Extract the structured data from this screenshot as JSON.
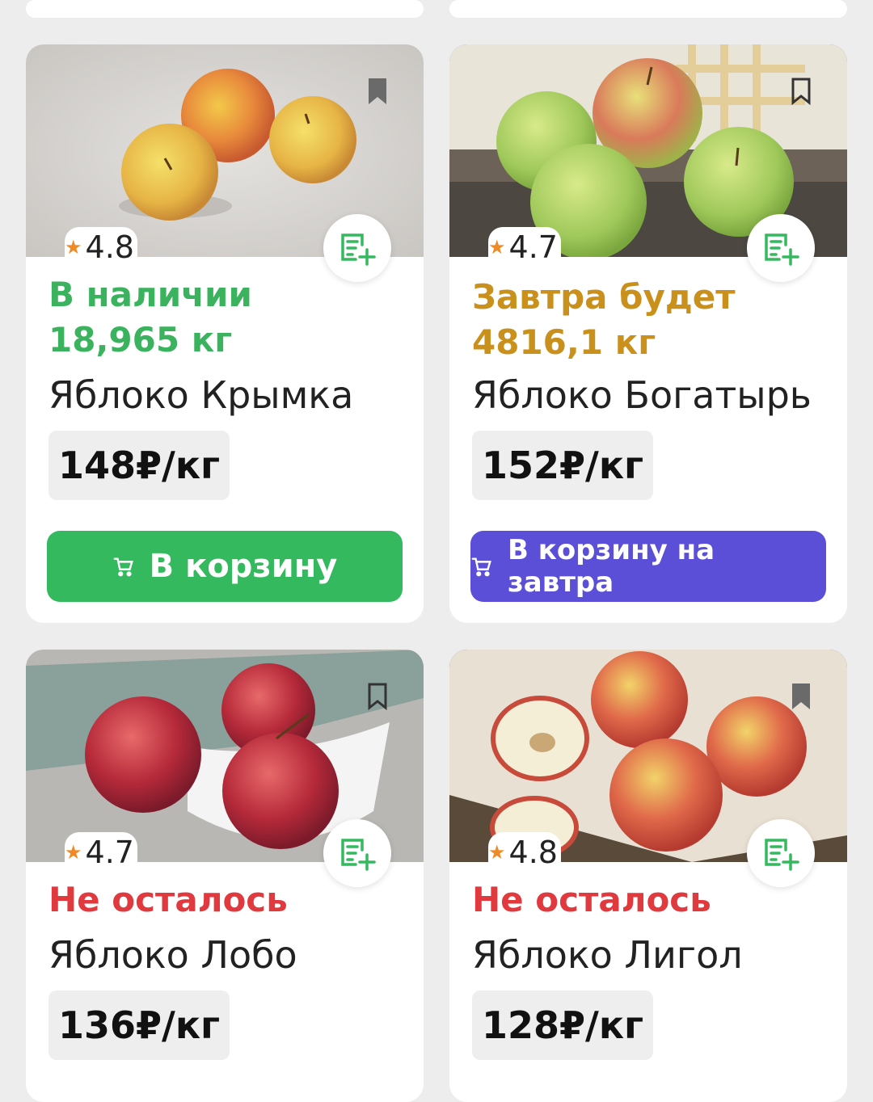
{
  "products": [
    {
      "rating": "4.8",
      "status": "В наличии 18,965 кг",
      "status_color": "#3bb35e",
      "name": "Яблоко Крымка",
      "price": "148₽/кг",
      "cart_label": "В корзину",
      "cart_color": "#35b95e"
    },
    {
      "rating": "4.7",
      "status": "Завтра будет 4816,1 кг",
      "status_color": "#c9901c",
      "name": "Яблоко Богатырь",
      "price": "152₽/кг",
      "cart_label": "В корзину на завтра",
      "cart_color": "#5a4fd6"
    },
    {
      "rating": "4.7",
      "status": "Не осталось",
      "status_color": "#e0393e",
      "name": "Яблоко Лобо",
      "price": "136₽/кг"
    },
    {
      "rating": "4.8",
      "status": "Не осталось",
      "status_color": "#e0393e",
      "name": "Яблоко Лигол",
      "price": "128₽/кг"
    }
  ],
  "icons": {
    "rating": "star-icon",
    "bookmark": "bookmark-icon",
    "add_to_list": "list-add-icon",
    "cart": "cart-icon"
  }
}
